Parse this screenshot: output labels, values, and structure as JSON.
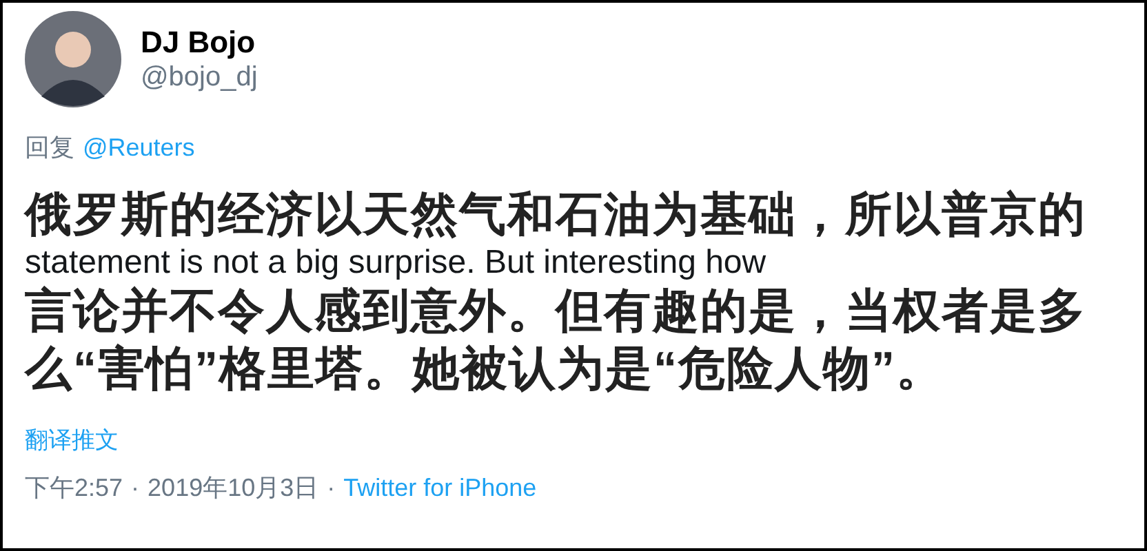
{
  "author": {
    "name": "DJ Bojo",
    "handle": "@bojo_dj"
  },
  "reply": {
    "label": "回复",
    "mention": "@Reuters"
  },
  "body": [
    {
      "kind": "subtitle",
      "text": "俄罗斯的经济以天然气和石油为基础，所以普京的"
    },
    {
      "kind": "tweet",
      "text": "statement is not a big surprise. But interesting how"
    },
    {
      "kind": "subtitle",
      "text": "言论并不令人感到意外。但有趣的是，当权者是多"
    },
    {
      "kind": "subtitle",
      "text": "么“害怕”格里塔。她被认为是“危险人物”。"
    }
  ],
  "translate": "翻译推文",
  "meta": [
    {
      "kind": "text",
      "text": "下午2:57"
    },
    {
      "kind": "sep",
      "text": "·"
    },
    {
      "kind": "text",
      "text": "2019年10月3日"
    },
    {
      "kind": "sep",
      "text": "·"
    },
    {
      "kind": "link",
      "text": "Twitter for iPhone"
    }
  ]
}
